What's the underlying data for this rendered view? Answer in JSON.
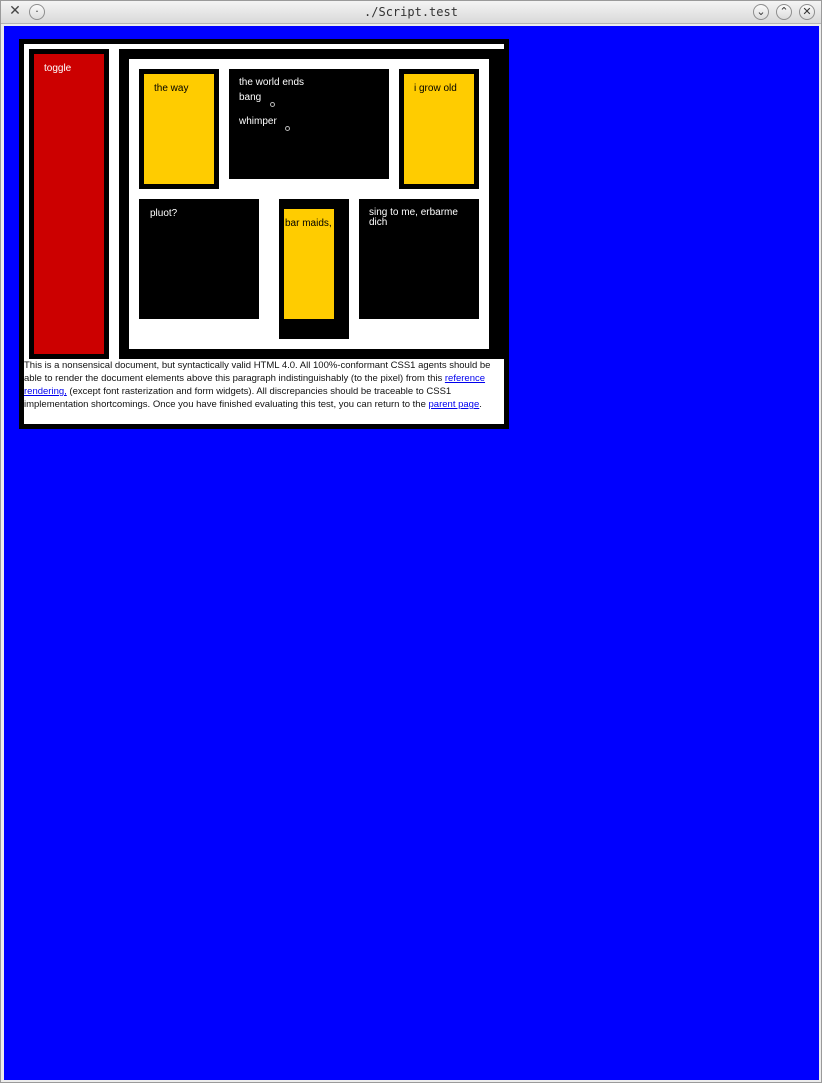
{
  "window": {
    "title": "./Script.test",
    "app_icon": "xfce-x-icon",
    "menu_glyph": "·",
    "minimize_glyph": "⌄",
    "maximize_glyph": "⌃",
    "close_glyph": "✕"
  },
  "colors": {
    "viewport_bg": "#0000ff",
    "red": "#cc0000",
    "yellow": "#ffcc00",
    "black": "#000000",
    "link": "#0000ee"
  },
  "doc": {
    "toggle": "toggle",
    "the_way": "the way",
    "world_ends": "the world ends",
    "bang": "bang",
    "whimper": "whimper",
    "grow_old": "i grow old",
    "pluot": "pluot?",
    "bar_maids": "bar maids,",
    "sing": "sing to me, erbarme dich",
    "para_before_link1": "This is a nonsensical document, but syntactically valid HTML 4.0. All 100%-conformant CSS1 agents should be able to render the document elements above this paragraph indistinguishably (to the pixel) from this ",
    "link1": "reference rendering,",
    "para_middle": " (except font rasterization and form widgets). All discrepancies should be traceable to CSS1 implementation shortcomings. Once you have finished evaluating this test, you can return to the ",
    "link2": "parent page",
    "para_end": "."
  }
}
